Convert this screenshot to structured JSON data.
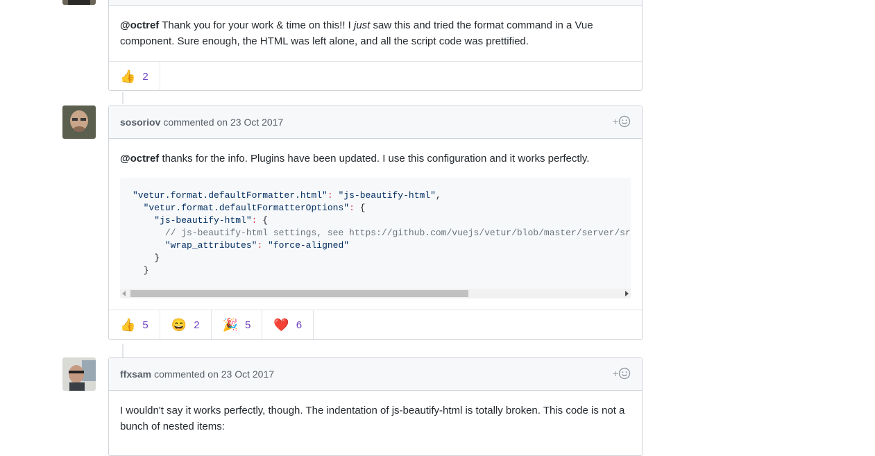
{
  "comments": [
    {
      "mention": "@octref",
      "text_before_em": " Thank you for your work & time on this!! I ",
      "emphasis": "just",
      "text_after_em": " saw this and tried the format command in a Vue component. Sure enough, the HTML was left alone, and all the script code was prettified.",
      "reactions": [
        {
          "emoji": "👍",
          "icon": "thumbs-up-icon",
          "count": "2"
        }
      ]
    },
    {
      "author": "sosoriov",
      "verb": "commented",
      "date": "on 23 Oct 2017",
      "add_reaction": "+",
      "mention": "@octref",
      "text": " thanks for the info. Plugins have been updated. I use this configuration and it works perfectly.",
      "code_lines": [
        {
          "k1": "\"vetur.format.defaultFormatter.html\"",
          "sep": ":",
          "v": " \"js-beautify-html\",",
          "indent": ""
        },
        {
          "k1": "\"vetur.format.defaultFormatterOptions\"",
          "sep": ":",
          "v": " {",
          "indent": "  "
        },
        {
          "k1": "\"js-beautify-html\"",
          "sep": ":",
          "v": " {",
          "indent": "    "
        },
        {
          "comment": "// js-beautify-html settings, see https://github.com/vuejs/vetur/blob/master/server/src/modes/template/services/htmlFormat.ts",
          "indent": "      "
        },
        {
          "k1": "\"wrap_attributes\"",
          "sep": ":",
          "v": " \"force-aligned\"",
          "indent": "      "
        },
        {
          "plain": "}",
          "indent": "    "
        },
        {
          "plain": "}",
          "indent": "  "
        }
      ],
      "reactions": [
        {
          "emoji": "👍",
          "icon": "thumbs-up-icon",
          "count": "5"
        },
        {
          "emoji": "😄",
          "icon": "smile-icon",
          "count": "2"
        },
        {
          "emoji": "🎉",
          "icon": "tada-icon",
          "count": "5"
        },
        {
          "emoji": "❤️",
          "icon": "heart-icon",
          "count": "6"
        }
      ]
    },
    {
      "author": "ffxsam",
      "verb": "commented",
      "date": "on 23 Oct 2017",
      "add_reaction": "+",
      "text": "I wouldn't say it works perfectly, though. The indentation of js-beautify-html is totally broken. This code is not a bunch of nested items:"
    }
  ]
}
